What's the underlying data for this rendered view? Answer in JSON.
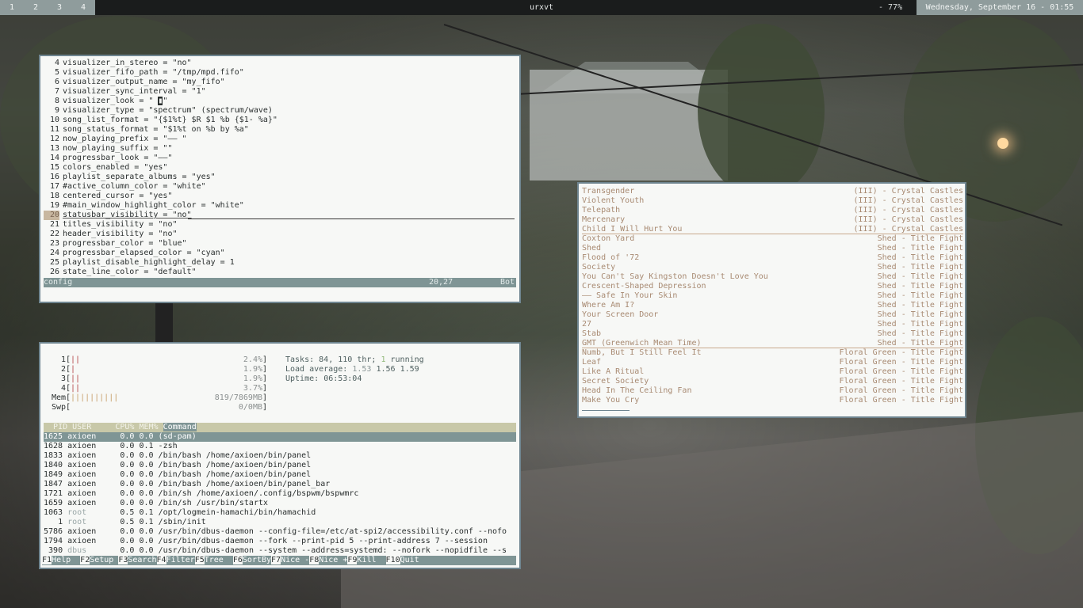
{
  "topbar": {
    "workspaces": [
      "1",
      "2",
      "3",
      "4"
    ],
    "title": "urxvt",
    "volume": "- 77%",
    "datetime": "Wednesday, September 16 - 01:55"
  },
  "vim": {
    "lines": [
      {
        "n": "4",
        "t": "visualizer_in_stereo = \"no\""
      },
      {
        "n": "5",
        "t": "visualizer_fifo_path = \"/tmp/mpd.fifo\""
      },
      {
        "n": "6",
        "t": "visualizer_output_name = \"my_fifo\""
      },
      {
        "n": "7",
        "t": "visualizer_sync_interval = \"1\""
      },
      {
        "n": "8",
        "pre": "visualizer_look = \" ",
        "cur": "▮",
        "post": "\""
      },
      {
        "n": "9",
        "t": "visualizer_type = \"spectrum\" (spectrum/wave)"
      },
      {
        "n": "10",
        "t": "song_list_format = \"{$1%t} $R $1 %b {$1- %a}\""
      },
      {
        "n": "11",
        "t": "song_status_format = \"$1%t on %b by %a\""
      },
      {
        "n": "12",
        "t": "now_playing_prefix = \"—— \""
      },
      {
        "n": "13",
        "t": "now_playing_suffix = \"\""
      },
      {
        "n": "14",
        "t": "progressbar_look = \"——\""
      },
      {
        "n": "15",
        "t": "colors_enabled = \"yes\""
      },
      {
        "n": "16",
        "t": "playlist_separate_albums = \"yes\""
      },
      {
        "n": "17",
        "t": "#active_column_color = \"white\""
      },
      {
        "n": "18",
        "t": "centered_cursor = \"yes\""
      },
      {
        "n": "19",
        "t": "#main_window_highlight_color = \"white\""
      },
      {
        "n": "20",
        "t": "statusbar_visibility = \"no\"",
        "current": true
      },
      {
        "n": "21",
        "t": "titles_visibility = \"no\""
      },
      {
        "n": "22",
        "t": "header_visibility = \"no\""
      },
      {
        "n": "23",
        "t": "progressbar_color = \"blue\""
      },
      {
        "n": "24",
        "t": "progressbar_elapsed_color = \"cyan\""
      },
      {
        "n": "25",
        "t": "playlist_disable_highlight_delay = 1"
      },
      {
        "n": "26",
        "t": "state_line_color = \"default\""
      }
    ],
    "status": {
      "file": "config",
      "pos": "20,27",
      "scroll": "Bot"
    }
  },
  "htop": {
    "cpus": [
      {
        "n": "1",
        "bars": "||",
        "pct": "2.4%"
      },
      {
        "n": "2",
        "bars": "|",
        "pct": "1.9%"
      },
      {
        "n": "3",
        "bars": "||",
        "pct": "1.9%"
      },
      {
        "n": "4",
        "bars": "||",
        "pct": "3.7%"
      }
    ],
    "mem": {
      "label": "Mem",
      "bars": "||||||||||",
      "val": "819/7869MB"
    },
    "swp": {
      "label": "Swp",
      "bars": "",
      "val": "0/0MB"
    },
    "tasks": {
      "label": "Tasks:",
      "count": "84,",
      "thr": "110 thr;",
      "running_n": "1",
      "running": "running"
    },
    "load": {
      "label": "Load average:",
      "l1": "1.53",
      "l5": "1.56",
      "l15": "1.59"
    },
    "uptime": {
      "label": "Uptime:",
      "value": "06:53:04"
    },
    "header": {
      "pid": "PID",
      "user": "USER",
      "cpu": "CPU%",
      "mem": "MEM%",
      "cmd": "Command"
    },
    "procs": [
      {
        "pid": "1625",
        "user": "axioen",
        "cpu": "0.0",
        "mem": "0.0",
        "cmd": "(sd-pam)",
        "sel": true
      },
      {
        "pid": "1628",
        "user": "axioen",
        "cpu": "0.0",
        "mem": "0.1",
        "cmd": "-zsh"
      },
      {
        "pid": "1833",
        "user": "axioen",
        "cpu": "0.0",
        "mem": "0.0",
        "cmd": "/bin/bash /home/axioen/bin/panel"
      },
      {
        "pid": "1840",
        "user": "axioen",
        "cpu": "0.0",
        "mem": "0.0",
        "cmd": "/bin/bash /home/axioen/bin/panel"
      },
      {
        "pid": "1849",
        "user": "axioen",
        "cpu": "0.0",
        "mem": "0.0",
        "cmd": "/bin/bash /home/axioen/bin/panel"
      },
      {
        "pid": "1847",
        "user": "axioen",
        "cpu": "0.0",
        "mem": "0.0",
        "cmd": "/bin/bash /home/axioen/bin/panel_bar"
      },
      {
        "pid": "1721",
        "user": "axioen",
        "cpu": "0.0",
        "mem": "0.0",
        "cmd": "/bin/sh /home/axioen/.config/bspwm/bspwmrc"
      },
      {
        "pid": "1659",
        "user": "axioen",
        "cpu": "0.0",
        "mem": "0.0",
        "cmd": "/bin/sh /usr/bin/startx"
      },
      {
        "pid": "1063",
        "user": "root",
        "cpu": "0.5",
        "mem": "0.1",
        "cmd": "/opt/logmein-hamachi/bin/hamachid"
      },
      {
        "pid": "1",
        "user": "root",
        "cpu": "0.5",
        "mem": "0.1",
        "cmd": "/sbin/init"
      },
      {
        "pid": "5786",
        "user": "axioen",
        "cpu": "0.0",
        "mem": "0.0",
        "cmd": "/usr/bin/dbus-daemon --config-file=/etc/at-spi2/accessibility.conf --nofo"
      },
      {
        "pid": "1794",
        "user": "axioen",
        "cpu": "0.0",
        "mem": "0.0",
        "cmd": "/usr/bin/dbus-daemon --fork --print-pid 5 --print-address 7 --session"
      },
      {
        "pid": "390",
        "user": "dbus",
        "cpu": "0.0",
        "mem": "0.0",
        "cmd": "/usr/bin/dbus-daemon --system --address=systemd: --nofork --nopidfile --s"
      }
    ],
    "fkeys": [
      {
        "k": "F1",
        "a": "Help  "
      },
      {
        "k": "F2",
        "a": "Setup "
      },
      {
        "k": "F3",
        "a": "Search"
      },
      {
        "k": "F4",
        "a": "Filter"
      },
      {
        "k": "F5",
        "a": "Tree  "
      },
      {
        "k": "F6",
        "a": "SortBy"
      },
      {
        "k": "F7",
        "a": "Nice -"
      },
      {
        "k": "F8",
        "a": "Nice +"
      },
      {
        "k": "F9",
        "a": "Kill  "
      },
      {
        "k": "F10",
        "a": "Quit"
      }
    ]
  },
  "ncmpcpp": {
    "songs": [
      {
        "title": "Transgender",
        "artist": "(III) - Crystal Castles"
      },
      {
        "title": "Violent Youth",
        "artist": "(III) - Crystal Castles"
      },
      {
        "title": "Telepath",
        "artist": "(III) - Crystal Castles"
      },
      {
        "title": "Mercenary",
        "artist": "(III) - Crystal Castles"
      },
      {
        "title": "Child I Will Hurt You",
        "artist": "(III) - Crystal Castles",
        "groupend": true
      },
      {
        "title": "Coxton Yard",
        "artist": "Shed - Title Fight"
      },
      {
        "title": "Shed",
        "artist": "Shed - Title Fight"
      },
      {
        "title": "Flood of '72",
        "artist": "Shed - Title Fight"
      },
      {
        "title": "Society",
        "artist": "Shed - Title Fight"
      },
      {
        "title": "You Can't Say Kingston Doesn't Love You",
        "artist": "Shed - Title Fight"
      },
      {
        "title": "Crescent-Shaped Depression",
        "artist": "Shed - Title Fight"
      },
      {
        "title": "—— Safe In Your Skin",
        "artist": "Shed - Title Fight"
      },
      {
        "title": "Where Am I?",
        "artist": "Shed - Title Fight"
      },
      {
        "title": "Your Screen Door",
        "artist": "Shed - Title Fight"
      },
      {
        "title": "27",
        "artist": "Shed - Title Fight"
      },
      {
        "title": "Stab",
        "artist": "Shed - Title Fight"
      },
      {
        "title": "GMT (Greenwich Mean Time)",
        "artist": "Shed - Title Fight",
        "groupend": true
      },
      {
        "title": "Numb, But I Still Feel It",
        "artist": "Floral Green - Title Fight"
      },
      {
        "title": "Leaf",
        "artist": "Floral Green - Title Fight"
      },
      {
        "title": "Like A Ritual",
        "artist": "Floral Green - Title Fight"
      },
      {
        "title": "Secret Society",
        "artist": "Floral Green - Title Fight"
      },
      {
        "title": "Head In The Ceiling Fan",
        "artist": "Floral Green - Title Fight"
      },
      {
        "title": "Make You Cry",
        "artist": "Floral Green - Title Fight"
      }
    ]
  }
}
